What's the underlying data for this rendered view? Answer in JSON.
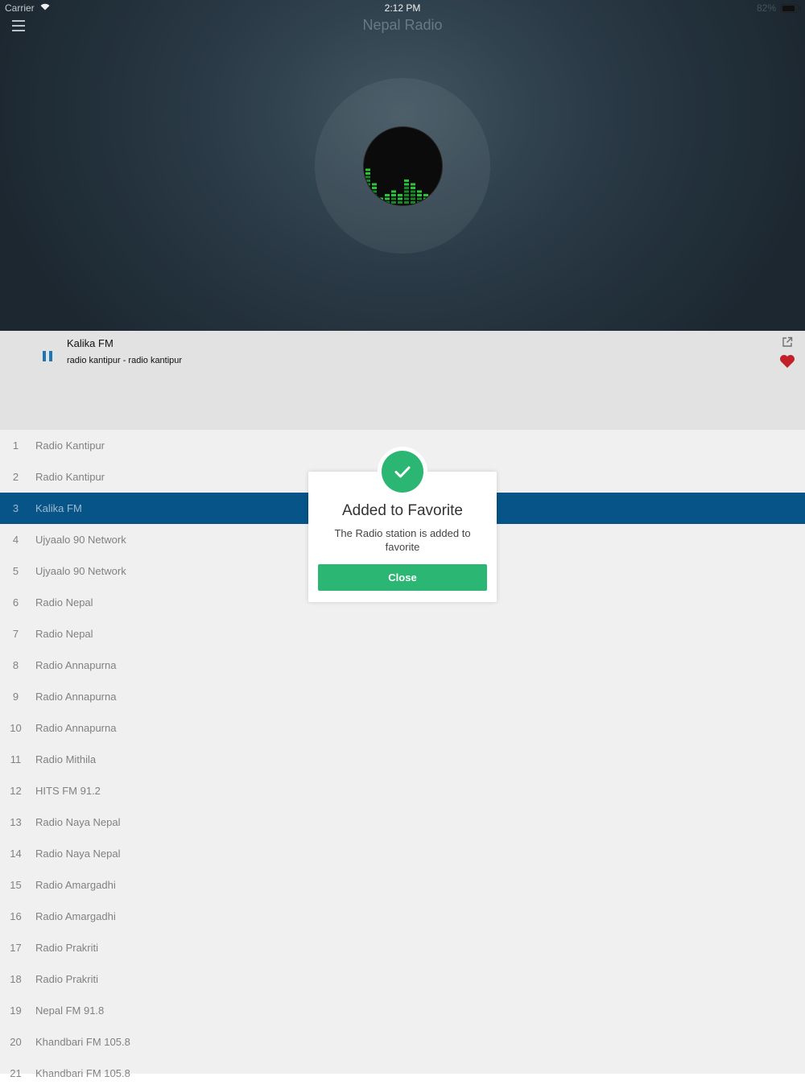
{
  "status_bar": {
    "carrier": "Carrier",
    "time": "2:12 PM",
    "battery_pct": "82%",
    "battery_level": 0.82
  },
  "header": {
    "title": "Nepal Radio"
  },
  "now_playing": {
    "title": "Kalika FM",
    "subtitle": "radio kantipur - radio kantipur"
  },
  "stations": [
    {
      "num": "1",
      "name": "Radio Kantipur"
    },
    {
      "num": "2",
      "name": "Radio Kantipur"
    },
    {
      "num": "3",
      "name": "Kalika FM"
    },
    {
      "num": "4",
      "name": "Ujyaalo 90 Network"
    },
    {
      "num": "5",
      "name": "Ujyaalo 90 Network"
    },
    {
      "num": "6",
      "name": "Radio Nepal"
    },
    {
      "num": "7",
      "name": "Radio Nepal"
    },
    {
      "num": "8",
      "name": "Radio Annapurna"
    },
    {
      "num": "9",
      "name": "Radio Annapurna"
    },
    {
      "num": "10",
      "name": "Radio Annapurna"
    },
    {
      "num": "11",
      "name": "Radio Mithila"
    },
    {
      "num": "12",
      "name": "HITS FM 91.2"
    },
    {
      "num": "13",
      "name": "Radio Naya Nepal"
    },
    {
      "num": "14",
      "name": "Radio Naya Nepal"
    },
    {
      "num": "15",
      "name": "Radio Amargadhi"
    },
    {
      "num": "16",
      "name": "Radio Amargadhi"
    },
    {
      "num": "17",
      "name": "Radio Prakriti"
    },
    {
      "num": "18",
      "name": "Radio Prakriti"
    },
    {
      "num": "19",
      "name": "Nepal FM 91.8"
    },
    {
      "num": "20",
      "name": "Khandbari FM 105.8"
    },
    {
      "num": "21",
      "name": "Khandbari FM 105.8"
    }
  ],
  "selected_index": 2,
  "modal": {
    "title": "Added to Favorite",
    "text": "The Radio station is added to favorite",
    "close_label": "Close"
  },
  "colors": {
    "accent": "#2bb673",
    "selected_row": "#075a91",
    "play_blue": "#1f7fc1",
    "heart": "#d0212b"
  }
}
